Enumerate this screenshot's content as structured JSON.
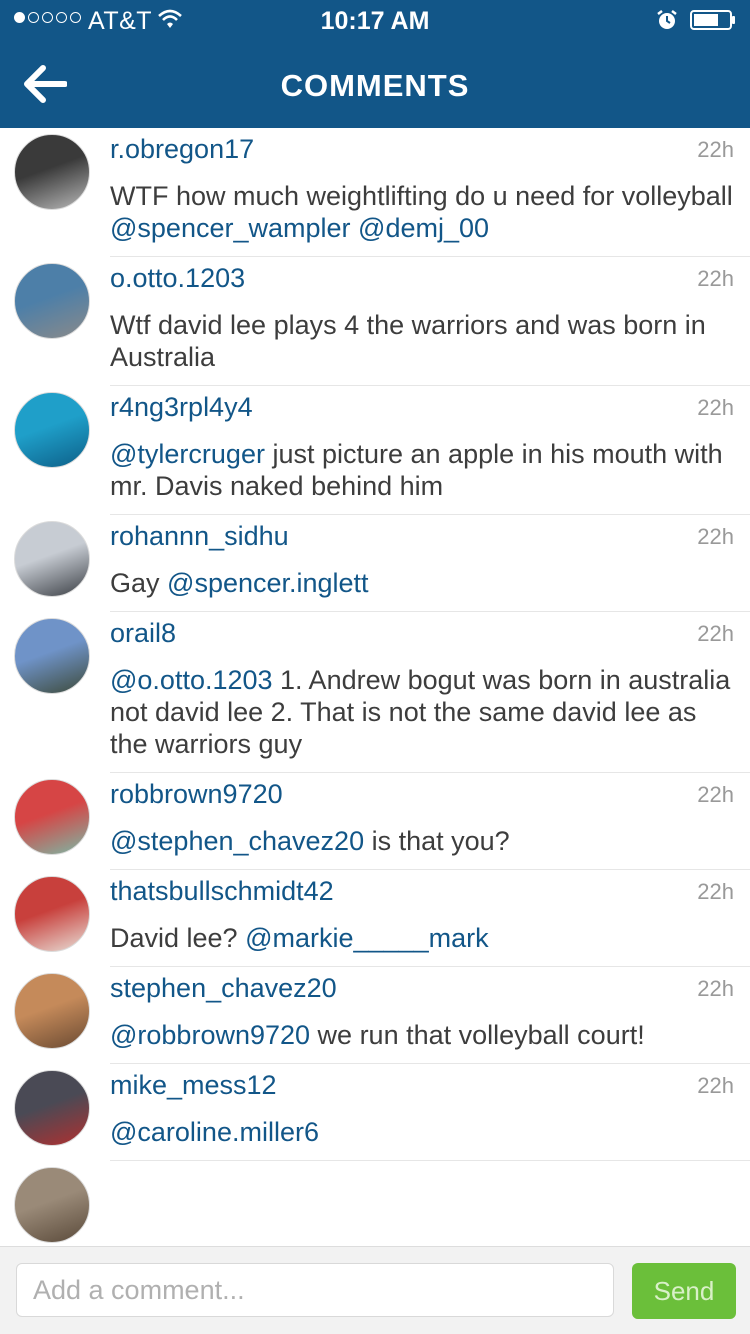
{
  "status_bar": {
    "carrier": "AT&T",
    "time": "10:17 AM",
    "signal_dots_filled": 1,
    "signal_dots_total": 5,
    "icons": [
      "wifi-icon",
      "alarm-icon",
      "battery-icon"
    ]
  },
  "nav": {
    "title": "COMMENTS",
    "back_icon": "arrow-left-icon"
  },
  "colors": {
    "header_bg": "#125688",
    "link": "#125688",
    "send_button": "#6bbf3a"
  },
  "comments": [
    {
      "username": "r.obregon17",
      "time": "22h",
      "parts": [
        {
          "t": "WTF how much weightlifting do u need for volleyball "
        },
        {
          "m": "@spencer_wampler"
        },
        {
          "t": " "
        },
        {
          "m": "@demj_00"
        }
      ],
      "avatar_colors": [
        "#3a3a3a",
        "#b9b9b9"
      ]
    },
    {
      "username": "o.otto.1203",
      "time": "22h",
      "parts": [
        {
          "t": "Wtf david lee plays 4 the warriors and was born in Australia"
        }
      ],
      "avatar_colors": [
        "#4d7fa8",
        "#8a8a8a"
      ]
    },
    {
      "username": "r4ng3rpl4y4",
      "time": "22h",
      "parts": [
        {
          "m": "@tylercruger"
        },
        {
          "t": " just picture an apple in his mouth with mr. Davis naked behind him"
        }
      ],
      "avatar_colors": [
        "#1f9fc9",
        "#0d5f88"
      ]
    },
    {
      "username": "rohannn_sidhu",
      "time": "22h",
      "parts": [
        {
          "t": "Gay  "
        },
        {
          "m": "@spencer.inglett"
        }
      ],
      "avatar_colors": [
        "#c7ccd3",
        "#3b3f45"
      ]
    },
    {
      "username": "orail8",
      "time": "22h",
      "parts": [
        {
          "m": "@o.otto.1203"
        },
        {
          "t": " 1. Andrew bogut was born in australia not david lee 2. That is not the same david lee as the warriors guy"
        }
      ],
      "avatar_colors": [
        "#6f93c8",
        "#3d4a3a"
      ]
    },
    {
      "username": "robbrown9720",
      "time": "22h",
      "parts": [
        {
          "m": "@stephen_chavez20"
        },
        {
          "t": " is that you?"
        }
      ],
      "avatar_colors": [
        "#d64545",
        "#7ab9a6"
      ]
    },
    {
      "username": "thatsbullschmidt42",
      "time": "22h",
      "parts": [
        {
          "t": "David lee? "
        },
        {
          "m": "@markie_____mark"
        }
      ],
      "avatar_colors": [
        "#c8403c",
        "#e8e0d8"
      ]
    },
    {
      "username": "stephen_chavez20",
      "time": "22h",
      "parts": [
        {
          "m": "@robbrown9720"
        },
        {
          "t": " we run that volleyball court!"
        }
      ],
      "avatar_colors": [
        "#c58a5a",
        "#6a4a32"
      ]
    },
    {
      "username": "mike_mess12",
      "time": "22h",
      "parts": [
        {
          "m": "@caroline.miller6"
        }
      ],
      "avatar_colors": [
        "#4a4a55",
        "#b03030"
      ]
    },
    {
      "username": "",
      "time": "",
      "parts": [],
      "avatar_colors": [
        "#9a8a78",
        "#5a4a3a"
      ]
    }
  ],
  "composer": {
    "placeholder": "Add a comment...",
    "value": "",
    "send_label": "Send"
  }
}
